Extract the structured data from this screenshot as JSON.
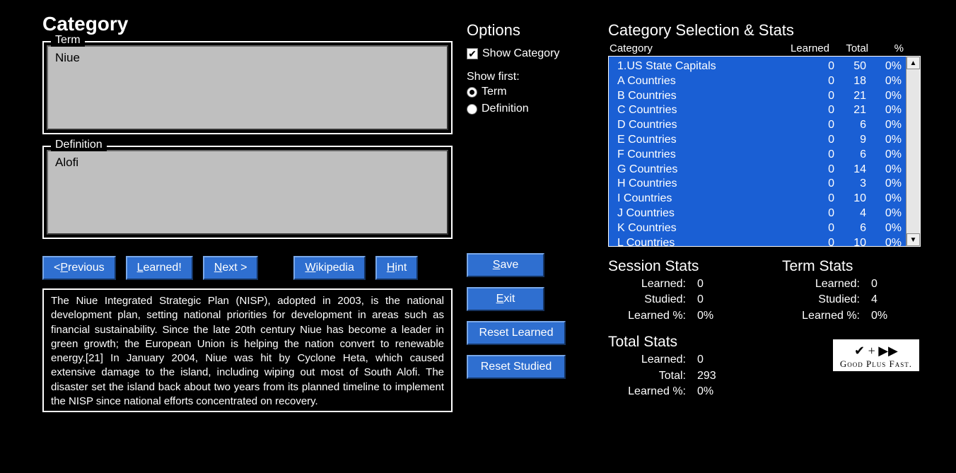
{
  "left": {
    "title": "Category",
    "term_legend": "Term",
    "term_value": "Niue",
    "def_legend": "Definition",
    "def_value": "Alofi",
    "buttons": {
      "previous": "< Previous",
      "learned": "Learned!",
      "next": "Next >",
      "wikipedia": "Wikipedia",
      "hint": "Hint"
    },
    "hint_text": "The Niue Integrated Strategic Plan (NISP), adopted in 2003, is the national development plan, setting national priorities for development in areas such as financial sustainability. Since the late 20th century Niue has become a leader in green growth; the European Union is helping the nation convert to renewable energy.[21] In January 2004, Niue was hit by Cyclone Heta, which caused extensive damage to the island, including wiping out most of South Alofi. The disaster set the island back about two years from its planned timeline to implement the NISP since national efforts concentrated on recovery."
  },
  "mid": {
    "options_title": "Options",
    "show_category": "Show Category",
    "show_first_label": "Show first:",
    "radio_term": "Term",
    "radio_definition": "Definition",
    "buttons": {
      "save": "Save",
      "exit": "Exit",
      "reset_learned": "Reset Learned",
      "reset_studied": "Reset Studied"
    }
  },
  "right": {
    "title": "Category Selection & Stats",
    "headers": {
      "category": "Category",
      "learned": "Learned",
      "total": "Total",
      "pct": "%"
    },
    "rows": [
      {
        "name": "1.US State Capitals",
        "learned": 0,
        "total": 50,
        "pct": "0%"
      },
      {
        "name": "A Countries",
        "learned": 0,
        "total": 18,
        "pct": "0%"
      },
      {
        "name": "B Countries",
        "learned": 0,
        "total": 21,
        "pct": "0%"
      },
      {
        "name": "C Countries",
        "learned": 0,
        "total": 21,
        "pct": "0%"
      },
      {
        "name": "D Countries",
        "learned": 0,
        "total": 6,
        "pct": "0%"
      },
      {
        "name": "E Countries",
        "learned": 0,
        "total": 9,
        "pct": "0%"
      },
      {
        "name": "F Countries",
        "learned": 0,
        "total": 6,
        "pct": "0%"
      },
      {
        "name": "G Countries",
        "learned": 0,
        "total": 14,
        "pct": "0%"
      },
      {
        "name": "H Countries",
        "learned": 0,
        "total": 3,
        "pct": "0%"
      },
      {
        "name": "I Countries",
        "learned": 0,
        "total": 10,
        "pct": "0%"
      },
      {
        "name": "J Countries",
        "learned": 0,
        "total": 4,
        "pct": "0%"
      },
      {
        "name": "K Countries",
        "learned": 0,
        "total": 6,
        "pct": "0%"
      },
      {
        "name": "L Countries",
        "learned": 0,
        "total": 10,
        "pct": "0%"
      }
    ],
    "session": {
      "title": "Session Stats",
      "learned_label": "Learned:",
      "learned_val": "0",
      "studied_label": "Studied:",
      "studied_val": "0",
      "pct_label": "Learned %:",
      "pct_val": "0%"
    },
    "term": {
      "title": "Term Stats",
      "learned_label": "Learned:",
      "learned_val": "0",
      "studied_label": "Studied:",
      "studied_val": "4",
      "pct_label": "Learned %:",
      "pct_val": "0%"
    },
    "total": {
      "title": "Total Stats",
      "learned_label": "Learned:",
      "learned_val": "0",
      "total_label": "Total:",
      "total_val": "293",
      "pct_label": "Learned %:",
      "pct_val": "0%"
    },
    "logo": {
      "icons": "✔ + ▶▶",
      "text": "Good Plus Fast."
    }
  }
}
